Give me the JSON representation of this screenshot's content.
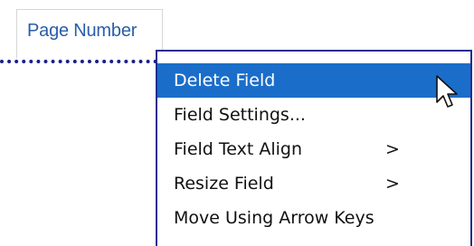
{
  "field": {
    "label": "Page Number"
  },
  "context_menu": {
    "items": [
      {
        "label": "Delete Field",
        "submenu_indicator": "",
        "active": true
      },
      {
        "label": "Field Settings...",
        "submenu_indicator": ""
      },
      {
        "label": "Field Text Align",
        "submenu_indicator": ">"
      },
      {
        "label": "Resize Field",
        "submenu_indicator": ">"
      },
      {
        "label": "Move Using Arrow Keys",
        "submenu_indicator": ""
      }
    ]
  },
  "colors": {
    "highlight": "#1a6ec9",
    "menu_border": "#1f2f8f",
    "field_text": "#2a5ea8",
    "dotted_line": "#1a1f8c"
  },
  "icons": {
    "cursor": "mouse-pointer-icon"
  }
}
